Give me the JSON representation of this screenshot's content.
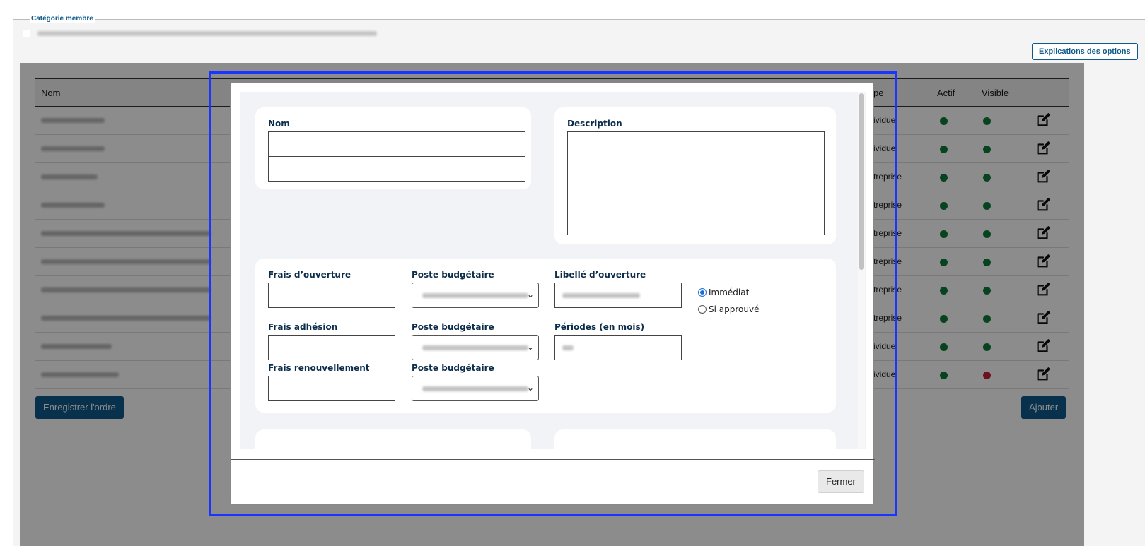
{
  "fieldset": {
    "legend": "Catégorie membre"
  },
  "options_button": "Explications des options",
  "table": {
    "headers": {
      "name": "Nom",
      "type": "pe",
      "active": "Actif",
      "visible": "Visible"
    },
    "rows": [
      {
        "type": "ividuel",
        "active": "green",
        "visible": "green"
      },
      {
        "type": "ividuel",
        "active": "green",
        "visible": "green"
      },
      {
        "type": "treprise",
        "active": "green",
        "visible": "green"
      },
      {
        "type": "treprise",
        "active": "green",
        "visible": "green"
      },
      {
        "type": "treprise",
        "active": "green",
        "visible": "green"
      },
      {
        "type": "treprise",
        "active": "green",
        "visible": "green"
      },
      {
        "type": "treprise",
        "active": "green",
        "visible": "green"
      },
      {
        "type": "treprise",
        "active": "green",
        "visible": "green"
      },
      {
        "type": "ividuel",
        "active": "green",
        "visible": "green"
      },
      {
        "type": "ividuel",
        "active": "green",
        "visible": "red"
      }
    ]
  },
  "buttons": {
    "save_order": "Enregistrer l'ordre",
    "add": "Ajouter"
  },
  "modal": {
    "name_label": "Nom",
    "description_label": "Description",
    "opening_fee_label": "Frais d’ouverture",
    "budget_post_label_1": "Poste budgétaire",
    "opening_label_label": "Libellé d’ouverture",
    "membership_fee_label": "Frais adhésion",
    "budget_post_label_2": "Poste budgétaire",
    "periods_label": "Périodes (en mois)",
    "renewal_fee_label": "Frais renouvellement",
    "budget_post_label_3": "Poste budgétaire",
    "radio_immediate": "Immédiat",
    "radio_if_approved": "Si approuvé",
    "close_button": "Fermer"
  },
  "colors": {
    "accent": "#0e5a8a",
    "highlight": "#1a35ff",
    "green": "#107a3a",
    "red": "#c4203a"
  }
}
